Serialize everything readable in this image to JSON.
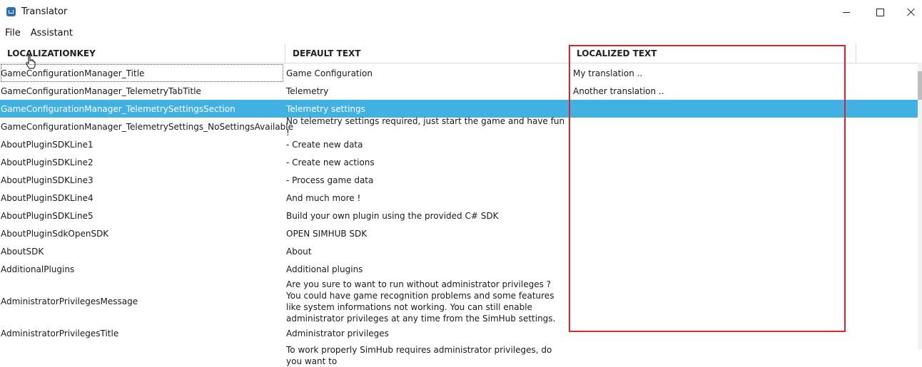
{
  "window": {
    "title": "Translator"
  },
  "menu": {
    "items": [
      "File",
      "Assistant"
    ]
  },
  "table": {
    "headers": {
      "key": "LOCALIZATIONKEY",
      "default": "DEFAULT TEXT",
      "localized": "LOCALIZED TEXT"
    },
    "rows": [
      {
        "key": "GameConfigurationManager_Title",
        "default": "Game Configuration",
        "localized": "My translation .."
      },
      {
        "key": "GameConfigurationManager_TelemetryTabTitle",
        "default": "Telemetry",
        "localized": "Another translation .."
      },
      {
        "key": "GameConfigurationManager_TelemetrySettingsSection",
        "default": "Telemetry settings",
        "localized": ""
      },
      {
        "key": "GameConfigurationManager_TelemetrySettings_NoSettingsAvailable",
        "default": "No telemetry settings required, just start the game and have fun !",
        "localized": ""
      },
      {
        "key": "AboutPluginSDKLine1",
        "default": "- Create new data",
        "localized": ""
      },
      {
        "key": "AboutPluginSDKLine2",
        "default": "- Create new actions",
        "localized": ""
      },
      {
        "key": "AboutPluginSDKLine3",
        "default": "- Process game data",
        "localized": ""
      },
      {
        "key": "AboutPluginSDKLine4",
        "default": "And much more !",
        "localized": ""
      },
      {
        "key": "AboutPluginSDKLine5",
        "default": "Build your own plugin using the provided C# SDK",
        "localized": ""
      },
      {
        "key": "AboutPluginSdkOpenSDK",
        "default": "OPEN SIMHUB SDK",
        "localized": ""
      },
      {
        "key": "AboutSDK",
        "default": "About",
        "localized": ""
      },
      {
        "key": "AdditionalPlugins",
        "default": "Additional plugins",
        "localized": ""
      },
      {
        "key": "AdministratorPrivilegesMessage",
        "default": "Are you sure to want to run without administrator privileges ? You could have game recognition problems and some features like system informations not working. You can still enable administrator privileges at any time from the SimHub settings.",
        "localized": ""
      },
      {
        "key": "AdministratorPrivilegesTitle",
        "default": "Administrator privileges",
        "localized": ""
      },
      {
        "key": "",
        "default": "To work properly SimHub requires administrator privileges, do you want to",
        "localized": ""
      }
    ],
    "selected_row": 2
  }
}
